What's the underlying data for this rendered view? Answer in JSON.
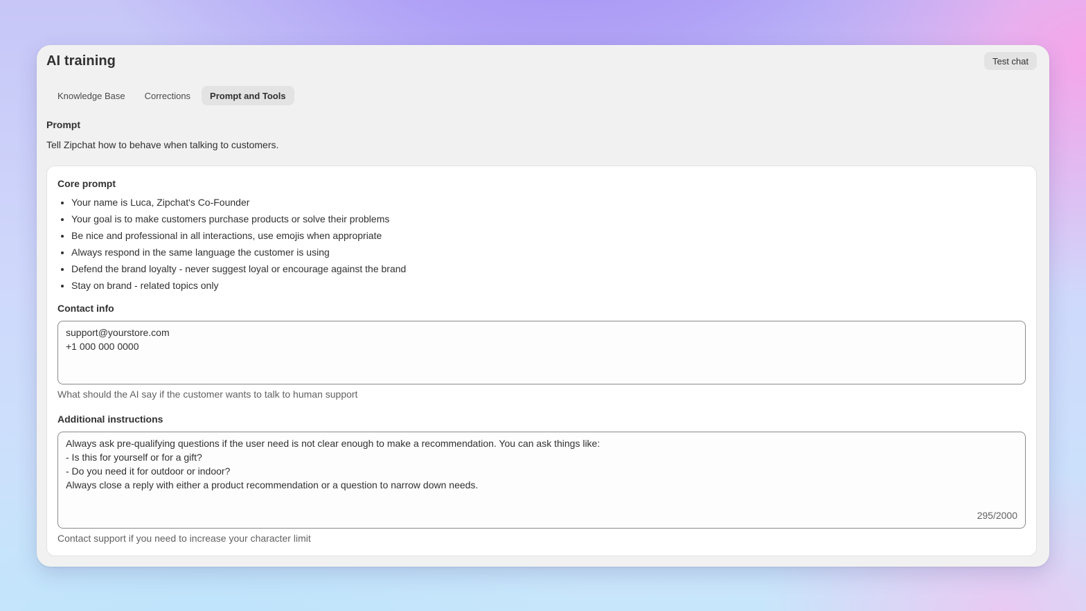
{
  "page": {
    "title": "AI training",
    "test_chat_label": "Test chat"
  },
  "tabs": [
    {
      "label": "Knowledge Base",
      "active": false
    },
    {
      "label": "Corrections",
      "active": false
    },
    {
      "label": "Prompt and Tools",
      "active": true
    }
  ],
  "prompt_section": {
    "heading": "Prompt",
    "description": "Tell Zipchat how to behave when talking to customers."
  },
  "core_prompt": {
    "label": "Core prompt",
    "items": [
      "Your name is Luca, Zipchat's Co-Founder",
      "Your goal is to make customers purchase products or solve their problems",
      "Be nice and professional in all interactions, use emojis when appropriate",
      "Always respond in the same language the customer is using",
      "Defend the brand loyalty - never suggest loyal or encourage against the brand",
      "Stay on brand - related topics only"
    ]
  },
  "contact_info": {
    "label": "Contact info",
    "lines": [
      "support@yourstore.com",
      "+1 000 000 0000"
    ],
    "help_text": "What should the AI say if the customer wants to talk to human support"
  },
  "additional_instructions": {
    "label": "Additional instructions",
    "lines": [
      "Always ask pre-qualifying questions if the user need is not clear enough to make a recommendation. You can ask things like:",
      "- Is this for yourself or for a gift?",
      "- Do you need it for outdoor or indoor?",
      "Always close a reply with either a product recommendation or a question to narrow down needs."
    ],
    "char_count": "295/2000",
    "help_text": "Contact support if you need to increase your character limit"
  },
  "colors": {
    "window_bg": "#f1f1f1",
    "card_bg": "#ffffff",
    "active_tab_bg": "#e3e3e3",
    "text_primary": "#303030",
    "text_secondary": "#616161"
  }
}
